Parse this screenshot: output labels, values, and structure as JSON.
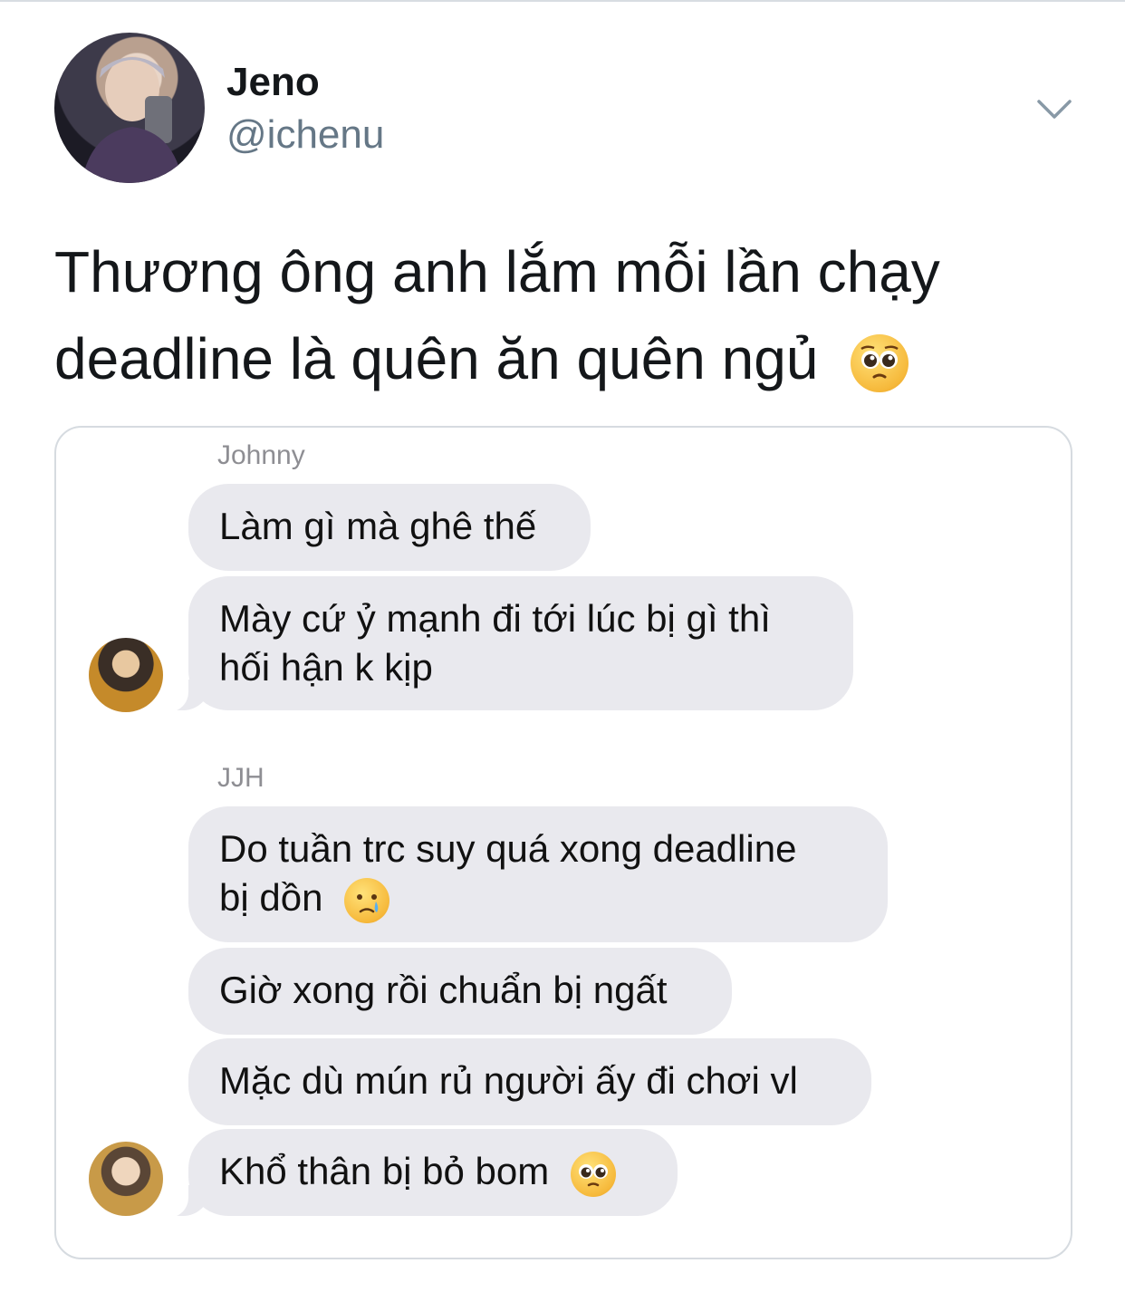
{
  "tweet": {
    "author": {
      "display_name": "Jeno",
      "handle": "@ichenu",
      "avatar_icon": "profile-photo"
    },
    "menu_icon": "chevron-down-icon",
    "text_line1": "Thương ông anh lắm mỗi lần chạy",
    "text_line2": "deadline là quên ăn quên ngủ",
    "text_emoji": "pleading-face-emoji"
  },
  "media": {
    "groups": [
      {
        "sender": "Johnny",
        "messages": [
          "Làm gì mà ghê thế",
          "Mày cứ ỷ mạnh đi tới lúc bị gì thì",
          "hối hận k kịp"
        ]
      },
      {
        "sender": "JJH",
        "messages": [
          "Do tuần trc suy quá xong deadline",
          "bị dồn",
          "Giờ xong rồi chuẩn bị ngất",
          "Mặc dù mún rủ người ấy đi chơi vl",
          "Khổ thân bị bỏ bom"
        ]
      }
    ],
    "emojis": [
      "crying-face-emoji",
      "pleading-face-emoji"
    ]
  },
  "colors": {
    "bubble": "#e9e9ee",
    "handle": "#657786",
    "border": "#d6dbe0"
  }
}
